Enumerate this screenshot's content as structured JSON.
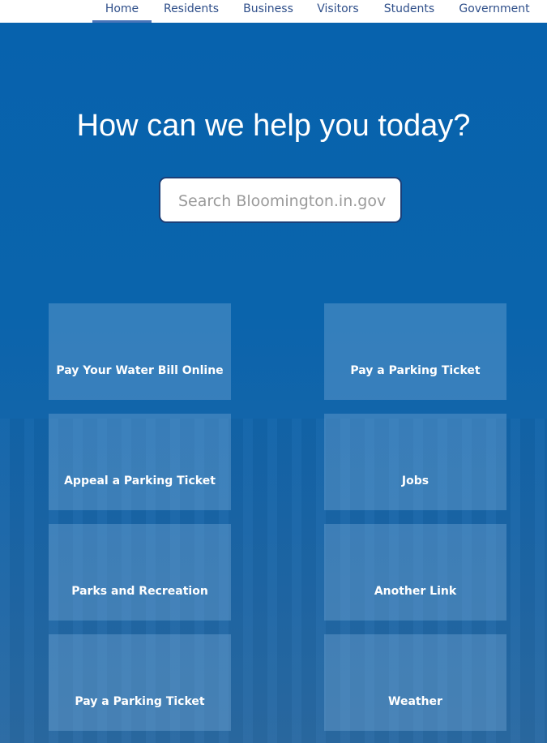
{
  "nav": {
    "items": [
      {
        "label": "Home",
        "active": true
      },
      {
        "label": "Residents"
      },
      {
        "label": "Business"
      },
      {
        "label": "Visitors"
      },
      {
        "label": "Students"
      },
      {
        "label": "Government"
      }
    ]
  },
  "hero": {
    "title": "How can we help you today?",
    "search_placeholder": "Search Bloomington.in.gov"
  },
  "tiles": [
    {
      "label": "Pay Your Water Bill Online"
    },
    {
      "label": "Pay a Parking Ticket"
    },
    {
      "label": "Appeal a Parking Ticket"
    },
    {
      "label": "Jobs"
    },
    {
      "label": "Parks and Recreation"
    },
    {
      "label": "Another Link"
    },
    {
      "label": "Pay a Parking Ticket"
    },
    {
      "label": "Weather"
    }
  ],
  "colors": {
    "background": "#0560a9",
    "nav_text": "#2f4f8a",
    "active_underline": "#4a74b8"
  }
}
